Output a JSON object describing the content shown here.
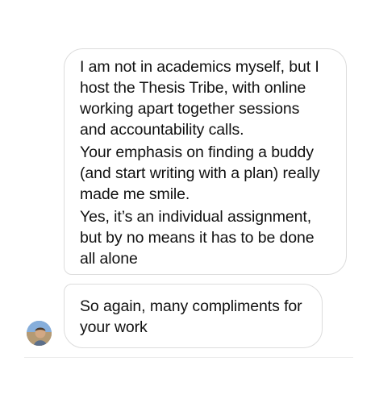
{
  "messages": [
    {
      "paragraphs": [
        "I am not in academics myself, but I\nhost the Thesis Tribe, with online\nworking apart together sessions\nand accountability calls.",
        "Your emphasis on finding a buddy\n(and start writing with a plan) really\nmade me smile.",
        "Yes, it’s an individual assignment,\nbut by no means it has to be done\nall alone"
      ]
    },
    {
      "paragraphs": [
        "So again, many compliments for\nyour work"
      ]
    }
  ],
  "colors": {
    "bubble_border": "#dcdcdc",
    "text": "#111111",
    "background": "#ffffff"
  },
  "icons": {
    "avatar": "sender-avatar"
  }
}
